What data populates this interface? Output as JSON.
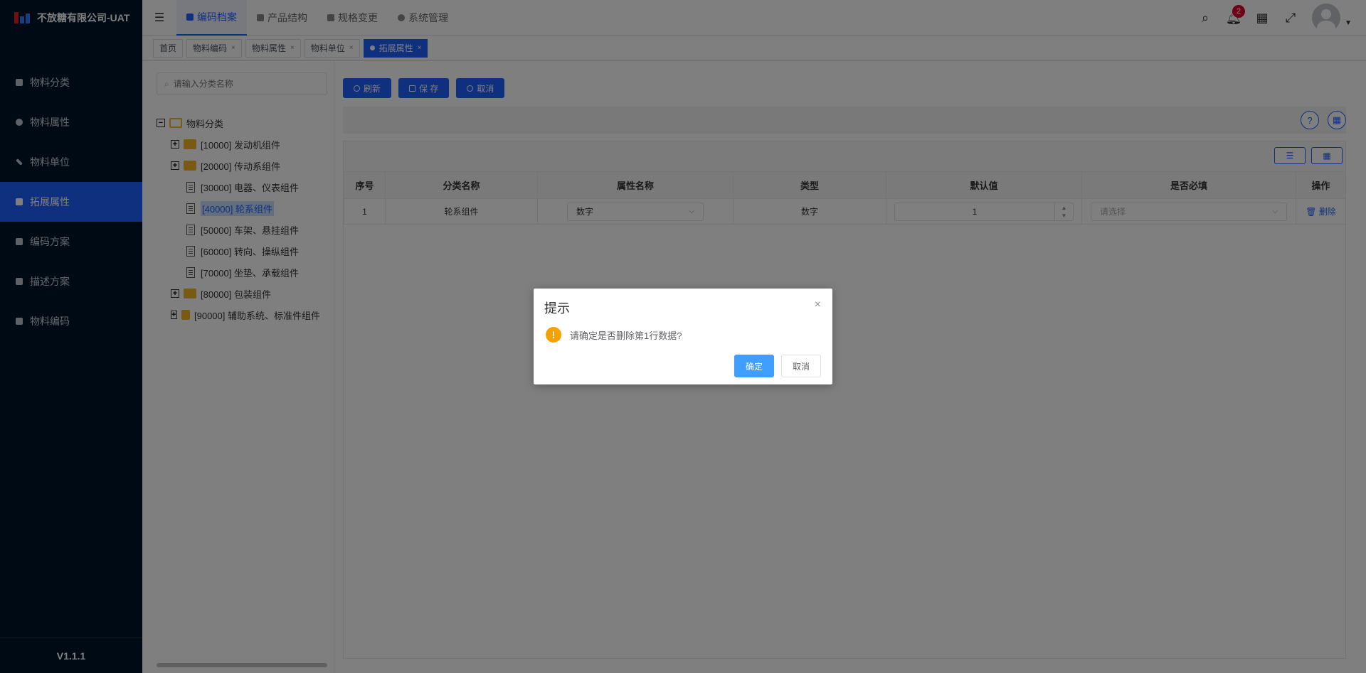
{
  "app": {
    "title": "不放糖有限公司-UAT",
    "version": "V1.1.1"
  },
  "sidebar": {
    "items": [
      {
        "label": "物料分类",
        "icon": "grid-icon"
      },
      {
        "label": "物料属性",
        "icon": "info-icon"
      },
      {
        "label": "物料单位",
        "icon": "ruler-icon"
      },
      {
        "label": "拓展属性",
        "icon": "extend-icon",
        "active": true
      },
      {
        "label": "编码方案",
        "icon": "book-icon"
      },
      {
        "label": "描述方案",
        "icon": "monitor-icon"
      },
      {
        "label": "物料编码",
        "icon": "doc-icon"
      }
    ]
  },
  "header": {
    "tabs": [
      {
        "label": "编码档案",
        "icon": "folder-icon",
        "active": true
      },
      {
        "label": "产品结构",
        "icon": "layers-icon"
      },
      {
        "label": "规格变更",
        "icon": "chart-icon"
      },
      {
        "label": "系统管理",
        "icon": "gear-icon"
      }
    ],
    "notification_count": "2"
  },
  "tags": {
    "items": [
      "首页",
      "物料编码",
      "物料属性",
      "物料单位",
      "拓展属性"
    ],
    "close": "×"
  },
  "tree": {
    "search_placeholder": "请输入分类名称",
    "root": "物料分类",
    "nodes": [
      {
        "label": "[10000] 发动机组件",
        "type": "folder"
      },
      {
        "label": "[20000] 传动系组件",
        "type": "folder"
      },
      {
        "label": "[30000] 电器、仪表组件",
        "type": "file"
      },
      {
        "label": "[40000] 轮系组件",
        "type": "file",
        "selected": true
      },
      {
        "label": "[50000] 车架、悬挂组件",
        "type": "file"
      },
      {
        "label": "[60000] 转向、操纵组件",
        "type": "file"
      },
      {
        "label": "[70000] 坐垫、承载组件",
        "type": "file"
      },
      {
        "label": "[80000] 包装组件",
        "type": "folder"
      },
      {
        "label": "[90000] 辅助系统、标准件组件",
        "type": "folder"
      }
    ]
  },
  "toolbar": {
    "refresh": "刷新",
    "save": "保 存",
    "cancel": "取消"
  },
  "grid": {
    "help": "?",
    "columns": [
      "序号",
      "分类名称",
      "属性名称",
      "类型",
      "默认值",
      "是否必填",
      "操作"
    ],
    "rows": [
      {
        "index": "1",
        "category": "轮系组件",
        "attr": "数字",
        "type": "数字",
        "default": "1",
        "required_placeholder": "请选择",
        "action": "删除"
      }
    ]
  },
  "dialog": {
    "title": "提示",
    "close": "×",
    "message": "请确定是否删除第1行数据?",
    "confirm": "确定",
    "cancel": "取消"
  },
  "colors": {
    "sidebar_bg": "#001529",
    "accent": "#1f5fff",
    "warning": "#f5a200",
    "dialog_ok": "#409eff"
  }
}
